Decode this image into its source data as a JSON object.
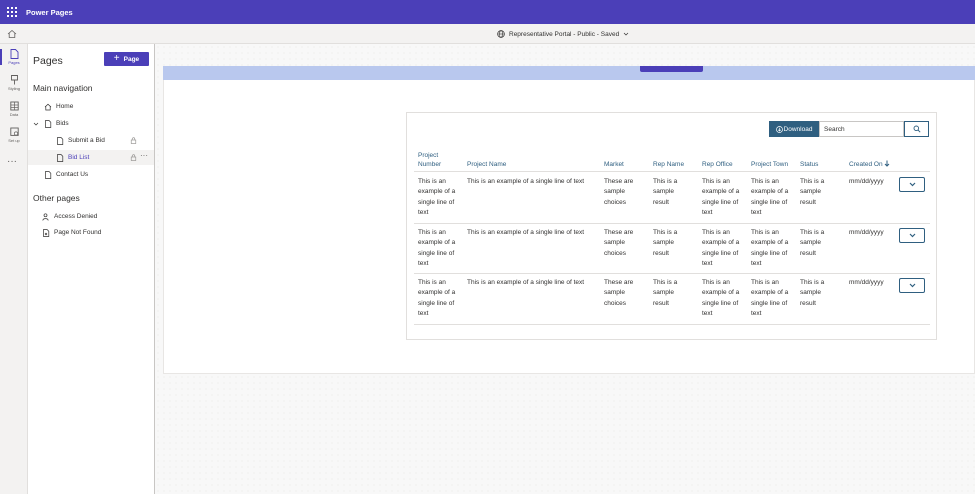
{
  "app": {
    "title": "Power Pages"
  },
  "subbar": {
    "site_status": "Representative Portal - Public - Saved"
  },
  "rail": [
    {
      "label": "Pages",
      "icon": "pages-icon"
    },
    {
      "label": "Styling",
      "icon": "styling-icon"
    },
    {
      "label": "Data",
      "icon": "data-icon"
    },
    {
      "label": "Set up",
      "icon": "setup-icon"
    }
  ],
  "panel": {
    "title": "Pages",
    "add_button": "Page",
    "main_nav_title": "Main navigation",
    "other_pages_title": "Other pages",
    "items": {
      "home": "Home",
      "bids": "Bids",
      "submit_bid": "Submit a Bid",
      "bid_list": "Bid List",
      "contact_us": "Contact Us",
      "access_denied": "Access Denied",
      "page_not_found": "Page Not Found"
    }
  },
  "list": {
    "download_label": "Download",
    "search_placeholder": "Search",
    "headers": {
      "project_number": "Project Number",
      "project_name": "Project Name",
      "market": "Market",
      "rep_name": "Rep Name",
      "rep_office": "Rep Office",
      "project_town": "Project Town",
      "status": "Status",
      "created_on": "Created On"
    },
    "rows": [
      {
        "project_number": "This is an example of a single line of text",
        "project_name": "This is an example of a single line of text",
        "market": "These are sample choices",
        "rep_name": "This is a sample result",
        "rep_office": "This is an example of a single line of text",
        "project_town": "This is an example of a single line of text",
        "status": "This is a sample result",
        "created_on": "mm/dd/yyyy"
      },
      {
        "project_number": "This is an example of a single line of text",
        "project_name": "This is an example of a single line of text",
        "market": "These are sample choices",
        "rep_name": "This is a sample result",
        "rep_office": "This is an example of a single line of text",
        "project_town": "This is an example of a single line of text",
        "status": "This is a sample result",
        "created_on": "mm/dd/yyyy"
      },
      {
        "project_number": "This is an example of a single line of text",
        "project_name": "This is an example of a single line of text",
        "market": "These are sample choices",
        "rep_name": "This is a sample result",
        "rep_office": "This is an example of a single line of text",
        "project_town": "This is an example of a single line of text",
        "status": "This is a sample result",
        "created_on": "mm/dd/yyyy"
      }
    ]
  },
  "colors": {
    "brand": "#4b3fb8",
    "link": "#2f5f80",
    "hero": "#b9c8ee"
  }
}
